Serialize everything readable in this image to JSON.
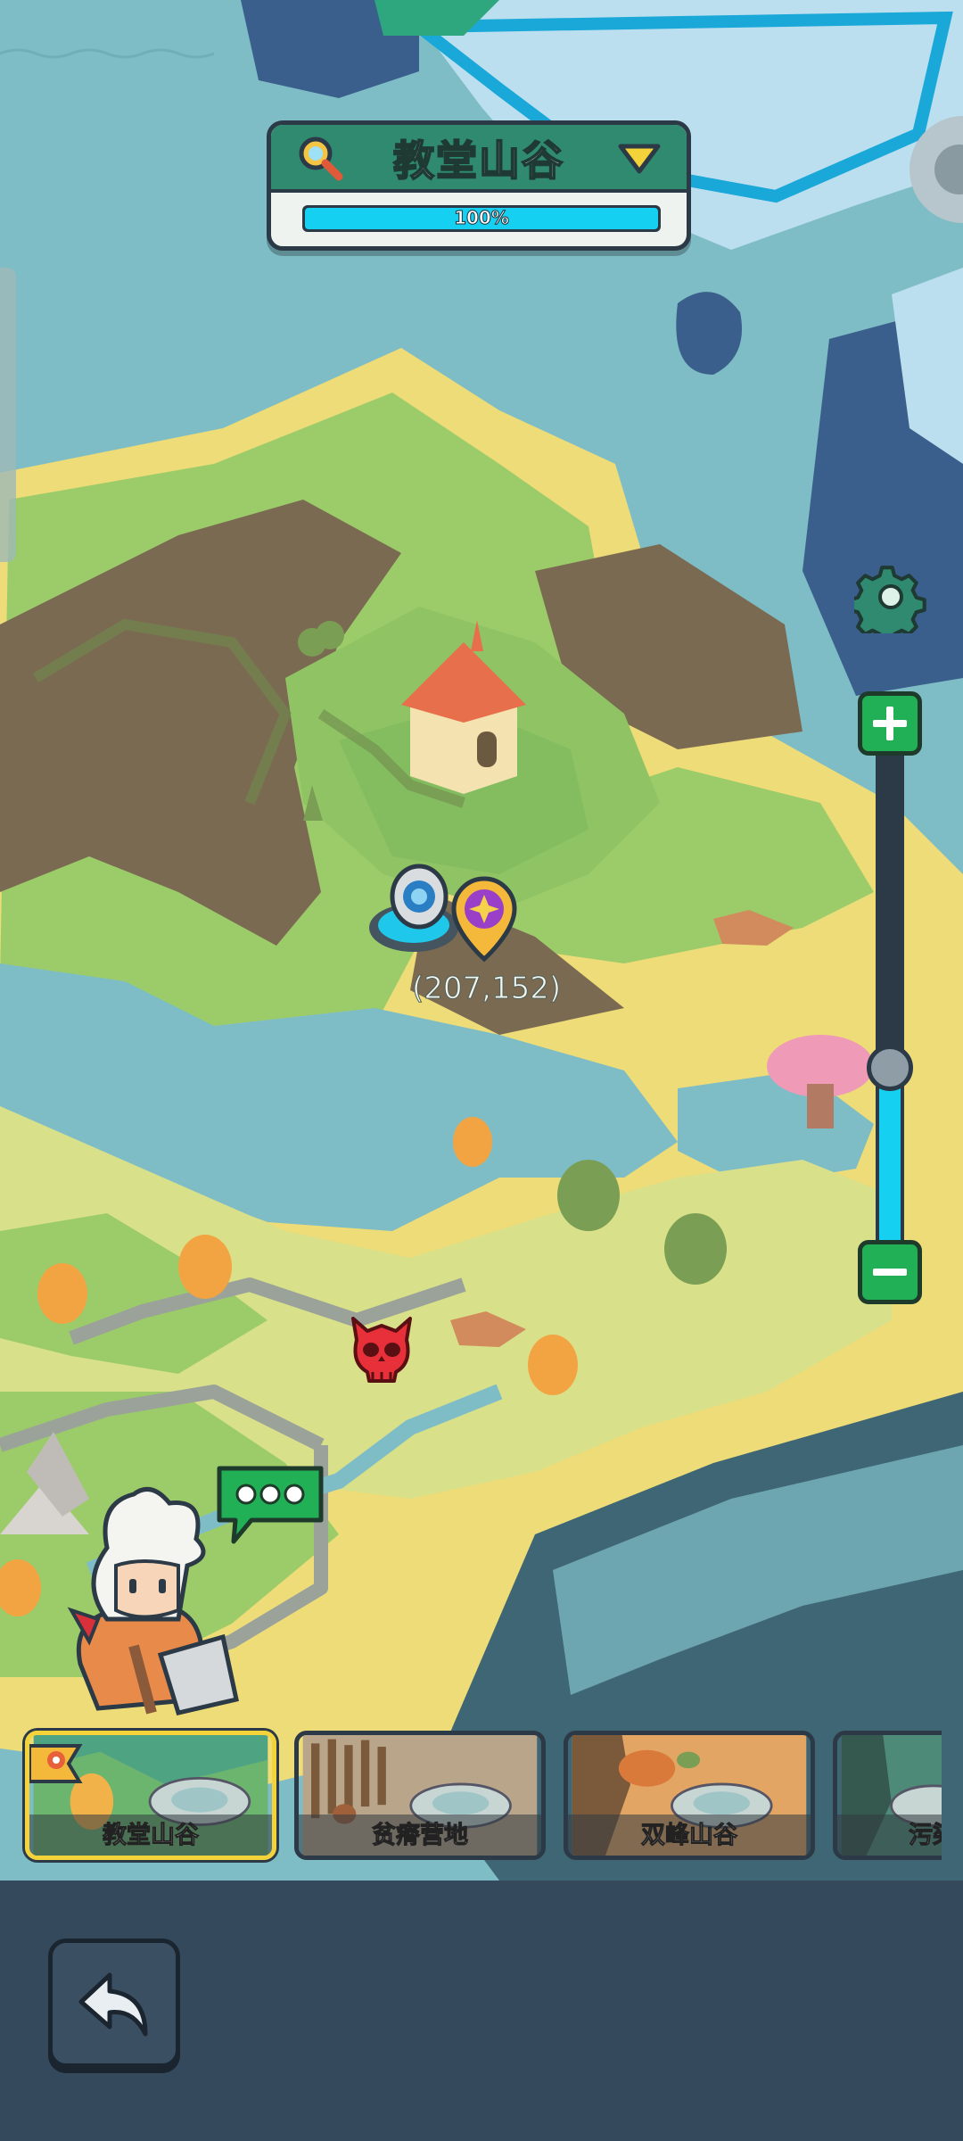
{
  "header": {
    "title": "教堂山谷",
    "progress_text": "100%",
    "progress": 1.0
  },
  "map": {
    "coordinate": "(207,152)",
    "zoom_level": 0.36
  },
  "regions": [
    {
      "label": "教堂山谷",
      "selected": true
    },
    {
      "label": "贫瘠营地",
      "selected": false
    },
    {
      "label": "双峰山谷",
      "selected": false
    },
    {
      "label": "污染",
      "selected": false
    }
  ],
  "icons": {
    "search": "search-icon",
    "dropdown": "chevron-down-icon",
    "settings": "gear-icon",
    "zoom_in": "plus-icon",
    "zoom_out": "minus-icon",
    "back": "back-arrow-icon",
    "chat": "chat-bubble-icon",
    "enemy": "demon-skull-icon",
    "waypoint": "star-pin-icon",
    "portal": "portal-icon"
  },
  "colors": {
    "accent": "#16d0f2",
    "header_green": "#2f8a6f",
    "button_green": "#22b057",
    "selected_border": "#f4d33a"
  }
}
